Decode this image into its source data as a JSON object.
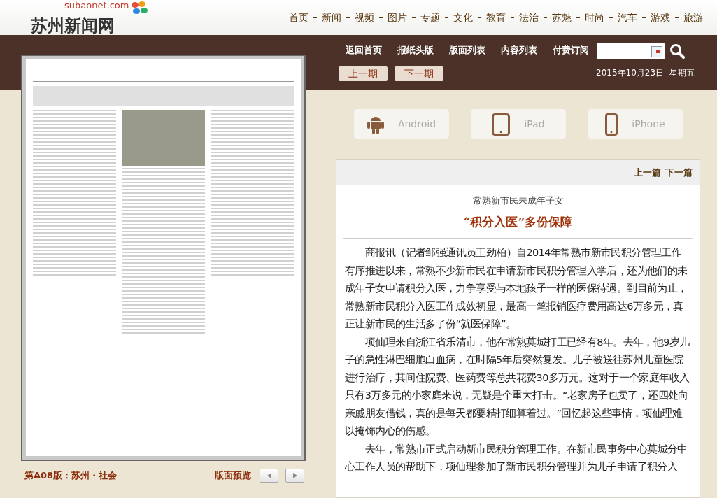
{
  "header": {
    "logo_domain": "subaonet.com",
    "logo_name": "苏州新闻网",
    "nav": [
      "首页",
      "新闻",
      "视频",
      "图片",
      "专题",
      "文化",
      "教育",
      "法治",
      "苏魅",
      "时尚",
      "汽车",
      "游戏",
      "旅游"
    ]
  },
  "toolbar": {
    "links": [
      "返回首页",
      "报纸头版",
      "版面列表",
      "内容列表",
      "付费订阅"
    ],
    "issue_buttons": [
      "上一期",
      "下一期"
    ],
    "date": "2015年10月23日  星期五"
  },
  "page_panel": {
    "edition": "第A08版：苏州・社会",
    "preview_label": "版面预览"
  },
  "apps": [
    {
      "kind": "android",
      "label": "Android"
    },
    {
      "kind": "tablet",
      "label": "iPad"
    },
    {
      "kind": "phone",
      "label": "iPhone"
    }
  ],
  "article": {
    "nav": [
      "上一篇",
      "下一篇"
    ],
    "subtitle": "常熟新市民未成年子女",
    "title": "“积分入医”多份保障",
    "paragraphs": [
      "商报讯（记者邹强通讯员王劲柏）自2014年常熟市新市民积分管理工作有序推进以来，常熟不少新市民在申请新市民积分管理入学后，还为他们的未成年子女申请积分入医，力争享受与本地孩子一样的医保待遇。到目前为止，常熟新市民积分入医工作成效初显，最高一笔报销医疗费用高达6万多元，真正让新市民的生活多了份“就医保障”。",
      "项仙理来自浙江省乐清市，他在常熟莫城打工已经有8年。去年，他9岁儿子的急性淋巴细胞白血病，在时隔5年后突然复发。儿子被送往苏州儿童医院进行治疗，其间住院费、医药费等总共花费30多万元。这对于一个家庭年收入只有3万多元的小家庭来说，无疑是个重大打击。“老家房子也卖了，还四处向亲戚朋友借钱，真的是每天都要精打细算着过。”回忆起这些事情，项仙理难以掩饰内心的伤感。",
      "去年，常熟市正式启动新市民积分管理工作。在新市民事务中心莫城分中心工作人员的帮助下，项仙理参加了新市民积分管理并为儿子申请了积分入"
    ]
  }
}
